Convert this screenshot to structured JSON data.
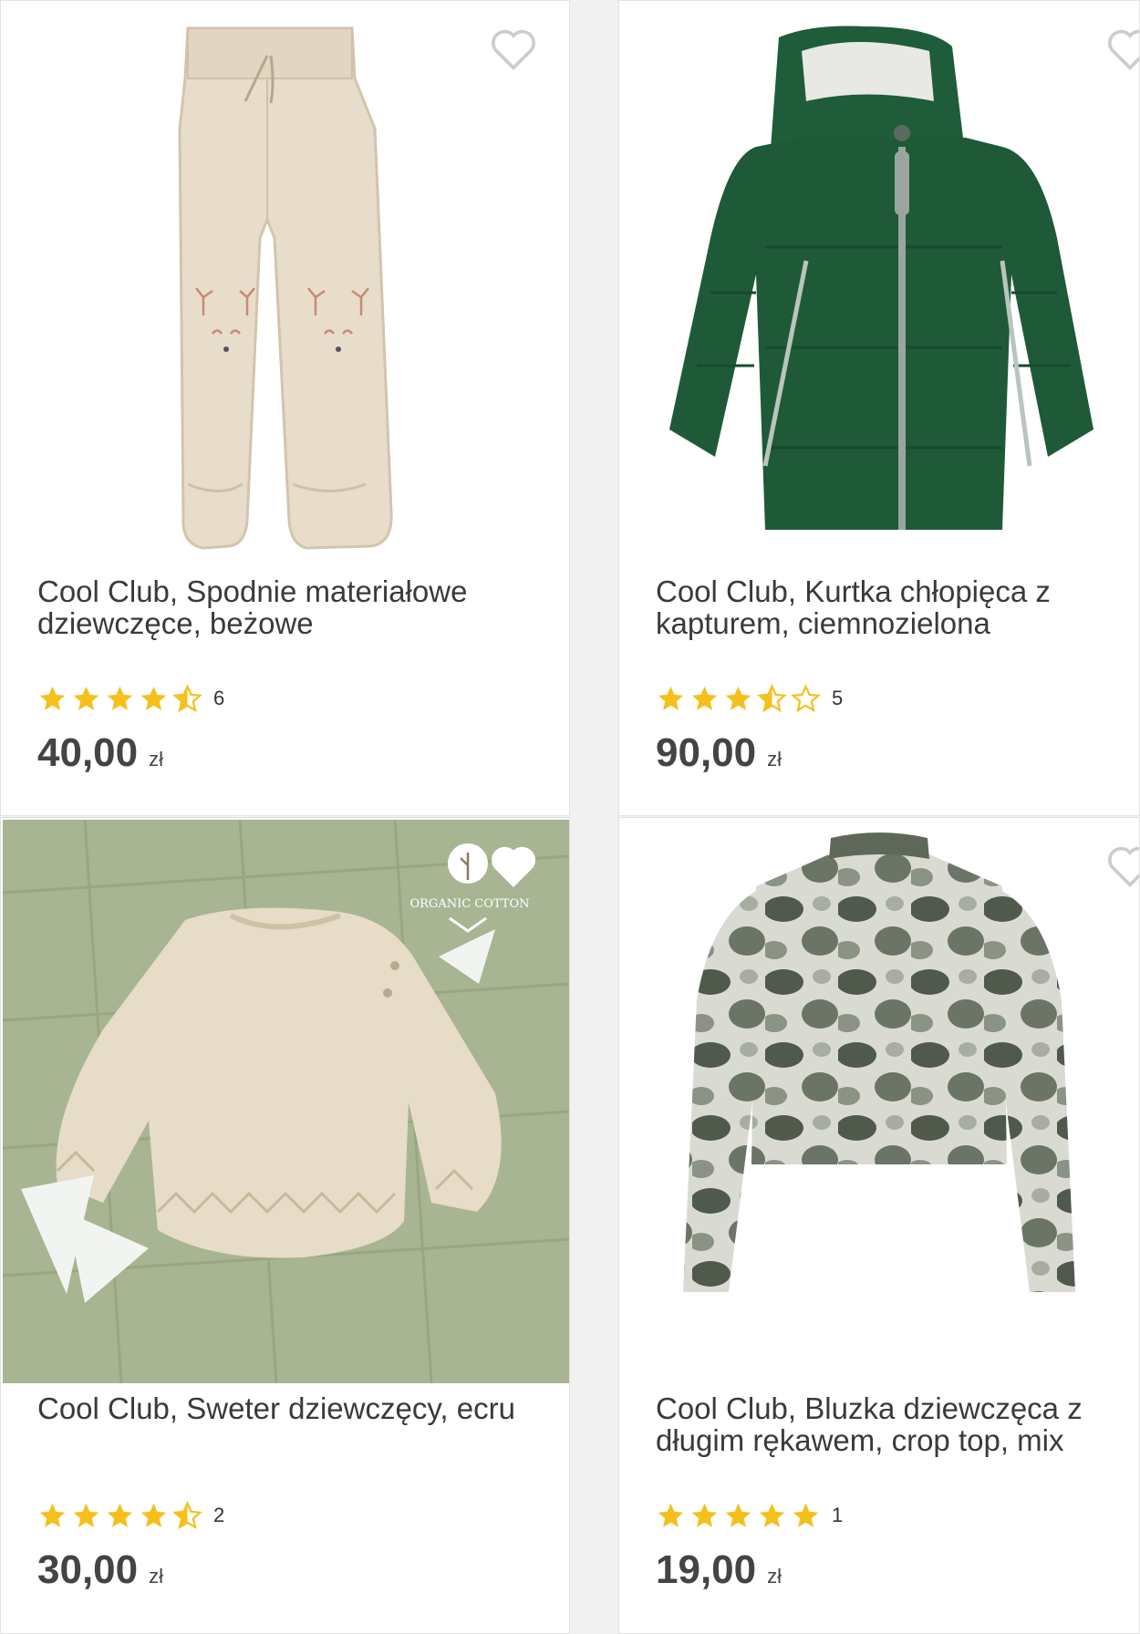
{
  "products": [
    {
      "title": "Cool Club, Spodnie materiałowe dziewczęce, beżowe",
      "rating": 4.5,
      "rating_count": "6",
      "price": "40,00",
      "currency": "zł"
    },
    {
      "title": "Cool Club, Kurtka chłopięca z kapturem, ciemnozielona",
      "rating": 3.5,
      "rating_count": "5",
      "price": "90,00",
      "currency": "zł"
    },
    {
      "title": "Cool Club, Sweter dziewczęcy, ecru",
      "rating": 4.5,
      "rating_count": "2",
      "price": "30,00",
      "currency": "zł",
      "badge": "ORGANIC COTTON"
    },
    {
      "title": "Cool Club, Bluzka dziewczęca z długim rękawem, crop top, mix",
      "rating": 5,
      "rating_count": "1",
      "price": "19,00",
      "currency": "zł"
    }
  ],
  "colors": {
    "star": "#f5c01c",
    "star_outline": "#f5c01c",
    "heart": "#cccccc"
  }
}
